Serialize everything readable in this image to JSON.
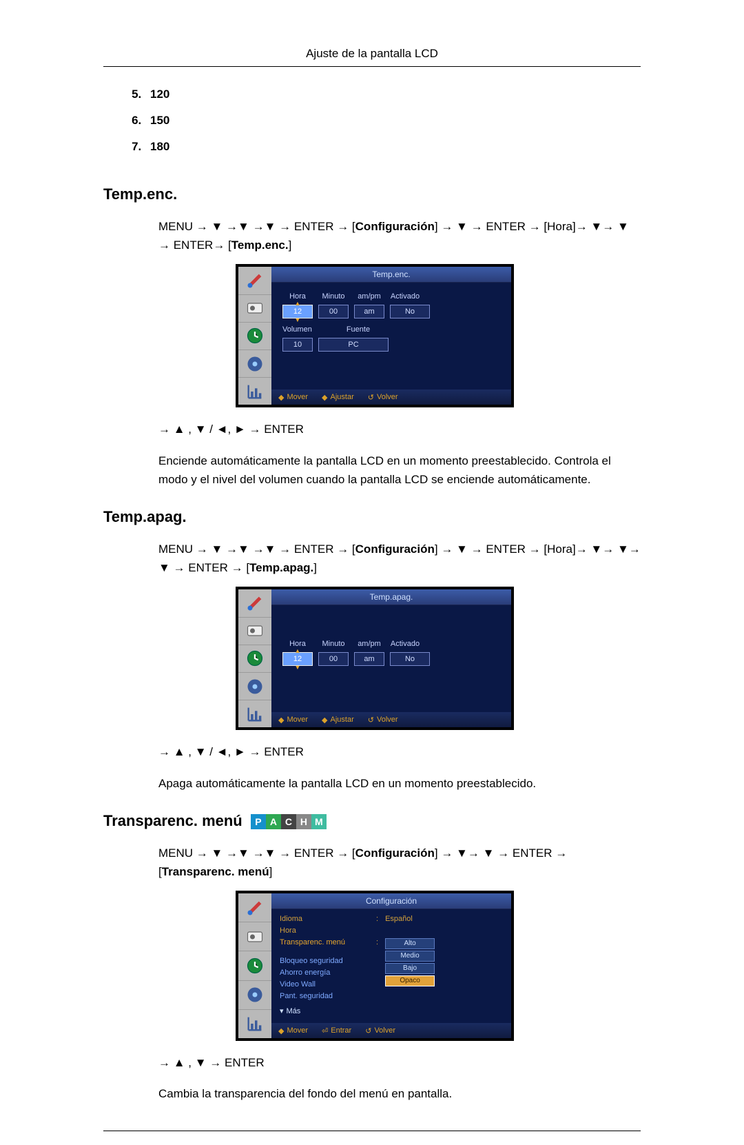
{
  "header": {
    "title": "Ajuste de la pantalla LCD"
  },
  "list": {
    "items": [
      "120",
      "150",
      "180"
    ]
  },
  "sections": {
    "tempenc": {
      "title": "Temp.enc.",
      "nav_prefix": "MENU → ▼ →▼ →▼ → ENTER → [",
      "nav_config": "Configuración",
      "nav_mid1": "] → ▼ → ENTER → [",
      "nav_hora": "Hora",
      "nav_mid2": "]→ ▼→ ▼ → ENTER→ [",
      "nav_label": "Temp.enc.",
      "nav_end": "]",
      "osd": {
        "title": "Temp.enc.",
        "cols": {
          "h": "Hora",
          "m": "Minuto",
          "a": "am/pm",
          "act": "Activado"
        },
        "vals": {
          "h": "12",
          "m": "00",
          "a": "am",
          "act": "No"
        },
        "labels": {
          "vol": "Volumen",
          "src": "Fuente"
        },
        "vals2": {
          "vol": "10",
          "src": "PC"
        },
        "footer": {
          "move": "Mover",
          "adj": "Ajustar",
          "ret": "Volver"
        }
      },
      "keys": "→ ▲ , ▼ / ◄, ► → ENTER",
      "desc": "Enciende automáticamente la pantalla LCD en un momento preestablecido. Controla el modo y el nivel del volumen cuando la pantalla LCD se enciende automáticamente."
    },
    "tempapag": {
      "title": "Temp.apag.",
      "nav_prefix": "MENU → ▼ →▼ →▼ → ENTER → [",
      "nav_config": "Configuración",
      "nav_mid1": "] → ▼ → ENTER → [",
      "nav_hora": "Hora",
      "nav_mid2": "]→ ▼→ ▼→ ▼ → ENTER → [",
      "nav_label": "Temp.apag.",
      "nav_end": "]",
      "osd": {
        "title": "Temp.apag.",
        "cols": {
          "h": "Hora",
          "m": "Minuto",
          "a": "am/pm",
          "act": "Activado"
        },
        "vals": {
          "h": "12",
          "m": "00",
          "a": "am",
          "act": "No"
        },
        "footer": {
          "move": "Mover",
          "adj": "Ajustar",
          "ret": "Volver"
        }
      },
      "keys": "→ ▲ , ▼ / ◄, ► → ENTER",
      "desc": "Apaga automáticamente la pantalla LCD en un momento preestablecido."
    },
    "transp": {
      "title": "Transparenc. menú",
      "badges": [
        "P",
        "A",
        "C",
        "H",
        "M"
      ],
      "nav_prefix": "MENU → ▼ →▼ →▼ → ENTER → [",
      "nav_config": "Configuración",
      "nav_mid": "] → ▼→ ▼ → ENTER → [",
      "nav_label": "Transparenc. menú",
      "nav_end": "]",
      "osd": {
        "title": "Configuración",
        "rows": {
          "idioma": {
            "l": "Idioma",
            "v": "Español"
          },
          "hora": {
            "l": "Hora"
          },
          "transp": {
            "l": "Transparenc. menú"
          },
          "bloqueo": {
            "l": "Bloqueo seguridad"
          },
          "ahorro": {
            "l": "Ahorro energía"
          },
          "video": {
            "l": "Video Wall"
          },
          "pant": {
            "l": "Pant. seguridad"
          },
          "mas": {
            "l": "Más"
          }
        },
        "opts": [
          "Alto",
          "Medio",
          "Bajo",
          "Opaco"
        ],
        "footer": {
          "move": "Mover",
          "ent": "Entrar",
          "ret": "Volver"
        }
      },
      "keys": "→ ▲ , ▼ → ENTER",
      "desc": "Cambia la transparencia del fondo del menú en pantalla."
    }
  }
}
